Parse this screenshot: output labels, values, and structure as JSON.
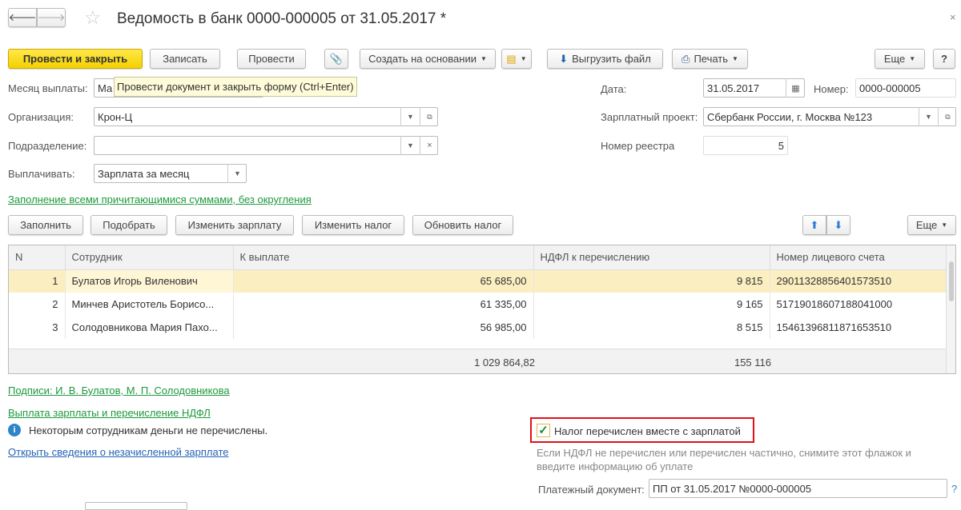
{
  "window": {
    "title": "Ведомость в банк 0000-000005 от 31.05.2017 *"
  },
  "toolbar": {
    "post_close": "Провести и закрыть",
    "save": "Записать",
    "post": "Провести",
    "create_based": "Создать на основании",
    "export_file": "Выгрузить файл",
    "print": "Печать",
    "more": "Еще",
    "help": "?"
  },
  "tooltip": "Провести документ и закрыть форму (Ctrl+Enter)",
  "form": {
    "month_label": "Месяц выплаты:",
    "month_value": "Ма",
    "org_label": "Организация:",
    "org_value": "Крон-Ц",
    "dept_label": "Подразделение:",
    "dept_value": "",
    "pay_label": "Выплачивать:",
    "pay_value": "Зарплата за месяц",
    "date_label": "Дата:",
    "date_value": "31.05.2017",
    "number_label": "Номер:",
    "number_value": "0000-000005",
    "project_label": "Зарплатный проект:",
    "project_value": "Сбербанк России, г. Москва №123",
    "registry_label": "Номер реестра",
    "registry_value": "5"
  },
  "fill_link": "Заполнение всеми причитающимися суммами, без округления",
  "table_toolbar": {
    "fill": "Заполнить",
    "pick": "Подобрать",
    "change_salary": "Изменить зарплату",
    "change_tax": "Изменить налог",
    "update_tax": "Обновить налог",
    "more": "Еще"
  },
  "table": {
    "columns": [
      "N",
      "Сотрудник",
      "К выплате",
      "НДФЛ к перечислению",
      "Номер лицевого счета"
    ],
    "rows": [
      {
        "n": "1",
        "name": "Булатов Игорь Виленович",
        "pay": "65 685,00",
        "tax": "9 815",
        "account": "29011328856401573510"
      },
      {
        "n": "2",
        "name": "Минчев Аристотель Борисо...",
        "pay": "61 335,00",
        "tax": "9 165",
        "account": "51719018607188041000"
      },
      {
        "n": "3",
        "name": "Солодовникова Мария Пахо...",
        "pay": "56 985,00",
        "tax": "8 515",
        "account": "15461396811871653510"
      }
    ],
    "totals": {
      "pay": "1 029 864,82",
      "tax": "155 116"
    }
  },
  "signatures_link": "Подписи: И. В. Булатов, М. П. Солодовникова",
  "section_link": "Выплата зарплаты и перечисление НДФЛ",
  "info_text": "Некоторым сотрудникам деньги не перечислены.",
  "open_link": "Открыть сведения о незачисленной зарплате",
  "tax_checkbox": {
    "label": "Налог перечислен вместе с зарплатой",
    "checked": true
  },
  "hint": "Если НДФЛ не перечислен или перечислен частично, снимите этот флажок и введите информацию об уплате",
  "payment_doc": {
    "label": "Платежный документ:",
    "value": "ПП от 31.05.2017 №0000-000005",
    "help": "?"
  }
}
